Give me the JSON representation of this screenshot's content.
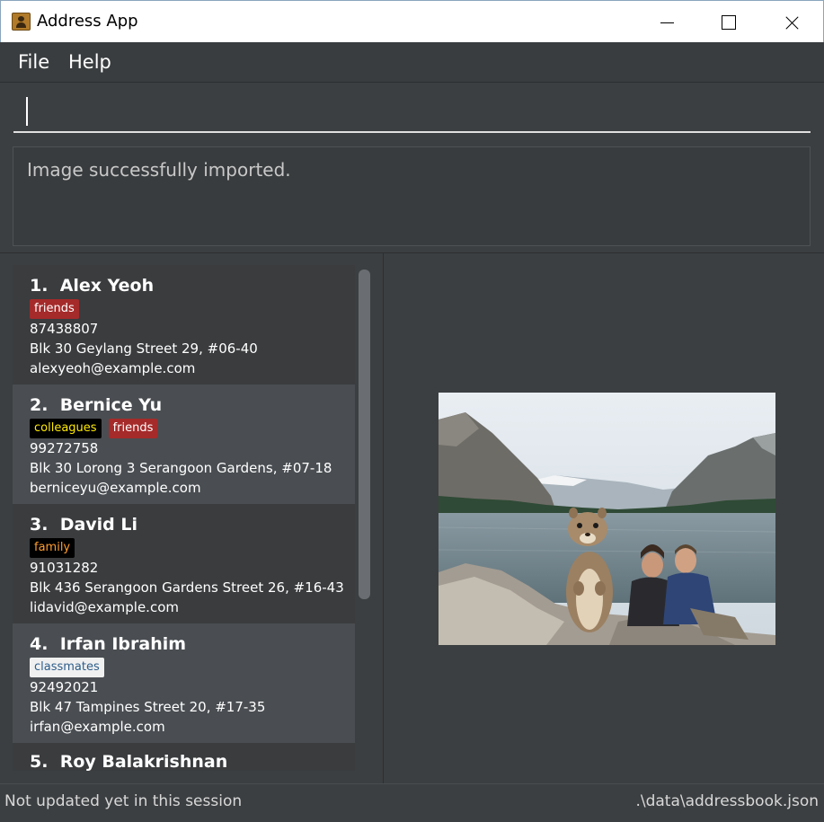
{
  "window": {
    "title": "Address App",
    "app_icon": "address-book-icon",
    "controls": [
      "minimize-icon",
      "maximize-icon",
      "close-icon"
    ]
  },
  "menu": {
    "items": [
      {
        "label": "File"
      },
      {
        "label": "Help"
      }
    ]
  },
  "command_box": {
    "value": "",
    "placeholder": ""
  },
  "result_display": {
    "message": "Image successfully imported."
  },
  "person_list": {
    "cards": [
      {
        "index": "1.",
        "name": "Alex Yeoh",
        "tags": [
          {
            "label": "friends",
            "color": "#a52a2a"
          }
        ],
        "phone": "87438807",
        "address": "Blk 30 Geylang Street 29, #06-40",
        "email": "alexyeoh@example.com"
      },
      {
        "index": "2.",
        "name": "Bernice Yu",
        "tags": [
          {
            "label": "colleagues",
            "color": "#000000"
          },
          {
            "label": "friends",
            "color": "#a52a2a"
          }
        ],
        "phone": "99272758",
        "address": "Blk 30 Lorong 3 Serangoon Gardens, #07-18",
        "email": "berniceyu@example.com"
      },
      {
        "index": "3.",
        "name": "David Li",
        "tags": [
          {
            "label": "family",
            "color": "#000000"
          }
        ],
        "phone": "91031282",
        "address": "Blk 436 Serangoon Gardens Street 26, #16-43",
        "email": "lidavid@example.com"
      },
      {
        "index": "4.",
        "name": "Irfan Ibrahim",
        "tags": [
          {
            "label": "classmates",
            "color": "#f0f0f0"
          }
        ],
        "phone": "92492021",
        "address": "Blk 47 Tampines Street 20, #17-35",
        "email": "irfan@example.com"
      },
      {
        "index": "5.",
        "name": "Roy Balakrishnan"
      }
    ]
  },
  "image_panel": {
    "image": "imported-photo"
  },
  "status_bar": {
    "sync_status": "Not updated yet in this session",
    "save_location": ".\\data\\addressbook.json"
  },
  "colors": {
    "background": "#3c3f41",
    "card_alt": "#4a4e52",
    "tag_friends": "#a52a2a",
    "tag_colleagues_text": "#ffea00",
    "tag_family_text": "#ff9d2e"
  }
}
